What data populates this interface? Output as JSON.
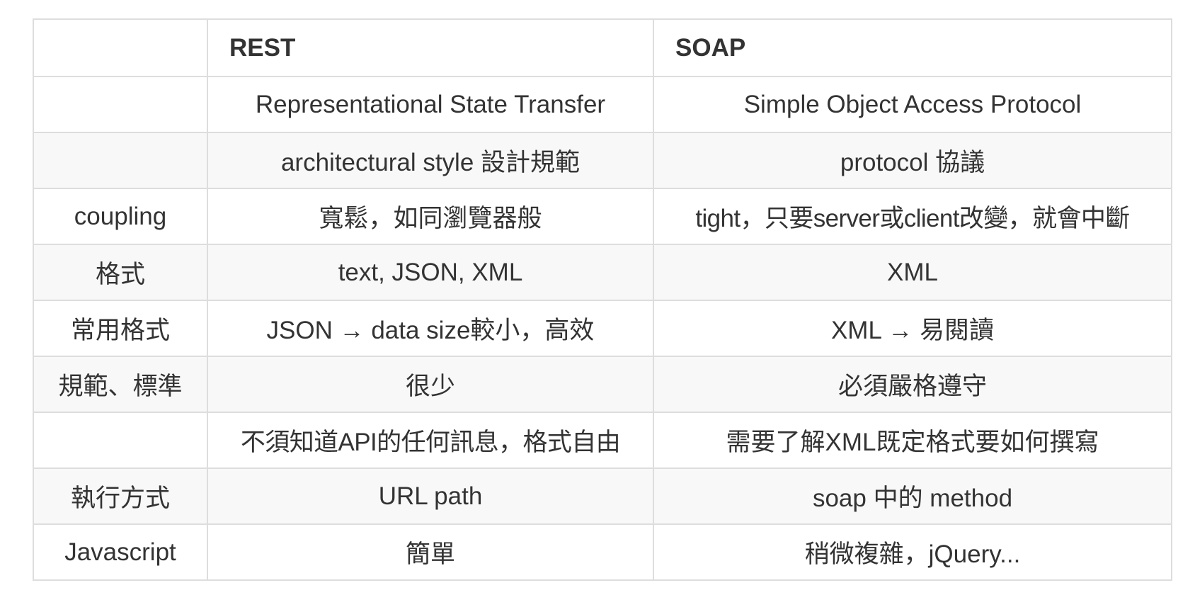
{
  "table": {
    "headers": [
      "",
      "REST",
      "SOAP"
    ],
    "rows": [
      [
        "",
        "Representational State Transfer",
        "Simple Object Access Protocol"
      ],
      [
        "",
        "architectural style 設計規範",
        "protocol 協議"
      ],
      [
        "coupling",
        "寬鬆，如同瀏覽器般",
        "tight，只要server或client改變，就會中斷"
      ],
      [
        "格式",
        "text, JSON, XML",
        "XML"
      ],
      [
        "常用格式",
        "JSON → data size較小，高效",
        "XML → 易閱讀"
      ],
      [
        "規範、標準",
        "很少",
        "必須嚴格遵守"
      ],
      [
        "",
        "不須知道API的任何訊息，格式自由",
        "需要了解XML既定格式要如何撰寫"
      ],
      [
        "執行方式",
        "URL path",
        "soap 中的 method"
      ],
      [
        "Javascript",
        "簡單",
        "稍微複雜，jQuery..."
      ]
    ]
  }
}
